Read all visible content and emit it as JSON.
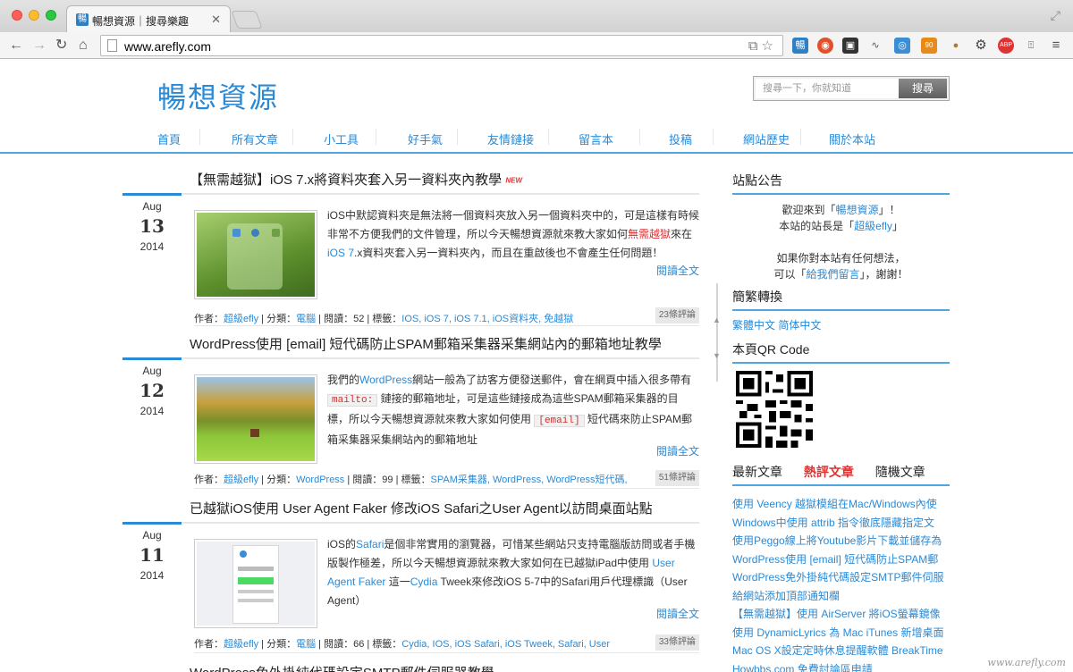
{
  "browser": {
    "tab_favicon": "暢",
    "tab_title": "暢想資源｜搜尋樂趣",
    "url": "www.arefly.com",
    "ext_badge": "90"
  },
  "site": {
    "logo": "暢想資源",
    "search_placeholder": "搜尋一下，你就知道",
    "search_button": "搜尋",
    "nav": [
      "首頁",
      "所有文章",
      "小工具",
      "好手氣",
      "友情鏈接",
      "留言本",
      "投稿",
      "網站歷史",
      "關於本站"
    ]
  },
  "posts": [
    {
      "title": "【無需越獄】iOS 7.x將資料夾套入另一資料夾內教學",
      "badge": "NEW",
      "month": "Aug",
      "day": "13",
      "year": "2014",
      "excerpt_html_parts": {
        "a": "iOS中默認資料夾是無法將一個資料夾放入另一個資料夾中的，可是這樣有時候非常不方便我們的文件管理，所以今天暢想資源就來教大家如何",
        "b": "無需越獄",
        "c": "來在",
        "d": "iOS 7",
        "e": ".x資料夾套入另一資料夾內，而且在重啟後也不會產生任何問題！"
      },
      "readmore": "閱讀全文",
      "meta": {
        "author_label": "作者：",
        "author": "超級efly",
        "cat_label": " | 分類：",
        "cat": "電腦",
        "views": " | 閱讀：52 | 標籤：",
        "tags": "IOS, iOS 7, iOS 7.1, iOS資料夾, 免越獄"
      },
      "comments": "23條評論"
    },
    {
      "title": "WordPress使用 [email] 短代碼防止SPAM郵箱采集器采集網站內的郵箱地址教學",
      "month": "Aug",
      "day": "12",
      "year": "2014",
      "excerpt_html_parts": {
        "a": "我們的",
        "b": "WordPress",
        "c": "網站一般為了訪客方便發送郵件，會在網頁中插入很多帶有",
        "code1": "mailto:",
        "d": "鏈接的郵箱地址，可是這些鏈接成為這些SPAM郵箱采集器的目標，所以今天暢想資源就來教大家如何使用",
        "code2": "[email]",
        "e": "短代碼來防止SPAM郵箱采集器采集網站內的郵箱地址"
      },
      "readmore": "閱讀全文",
      "meta": {
        "author_label": "作者：",
        "author": "超級efly",
        "cat_label": " | 分類：",
        "cat": "WordPress",
        "views": " | 閱讀：99 | 標籤：",
        "tags": "SPAM采集器, WordPress, WordPress短代碼,"
      },
      "comments": "51條評論"
    },
    {
      "title": "已越獄iOS使用 User Agent Faker 修改iOS Safari之User Agent以訪問桌面站點",
      "month": "Aug",
      "day": "11",
      "year": "2014",
      "excerpt_html_parts": {
        "a": "iOS的",
        "b": "Safari",
        "c": "是個非常實用的瀏覽器，可惜某些網站只支持電腦版訪問或者手機版製作極差，所以今天暢想資源就來教大家如何在已越獄iPad中使用 ",
        "d": "User Agent Faker",
        "e": " 這一",
        "f": "Cydia",
        "g": " Tweek來修改iOS 5-7中的Safari用戶代理標識（User Agent）"
      },
      "readmore": "閱讀全文",
      "meta": {
        "author_label": "作者：",
        "author": "超級efly",
        "cat_label": " | 分類：",
        "cat": "電腦",
        "views": " | 閱讀：66 | 標籤：",
        "tags": "Cydia, IOS, iOS Safari, iOS Tweek, Safari, User"
      },
      "comments": "33條評論"
    },
    {
      "title": "WordPress免外掛純代碼設定SMTP郵件伺服器教學"
    }
  ],
  "sidebar": {
    "notice_title": "站點公告",
    "notice_line1_pre": "歡迎來到「",
    "notice_line1_link": "暢想資源",
    "notice_line1_post": "」！",
    "notice_line2_pre": "本站的站長是「",
    "notice_line2_link": "超級efly",
    "notice_line2_post": "」",
    "notice_line3": "如果你對本站有任何想法，",
    "notice_line4_pre": "可以「",
    "notice_line4_link": "給我們留言",
    "notice_line4_post": "」，謝謝！",
    "convert_title": "簡繁轉換",
    "convert_trad": "繁體中文",
    "convert_simp": "简体中文",
    "qr_title": "本頁QR Code",
    "tabs": [
      "最新文章",
      "熱評文章",
      "隨機文章"
    ],
    "recent": [
      "使用 Veency 越獄模組在Mac/Windows內使",
      "Windows中使用 attrib 指令徹底隱藏指定文",
      "使用Peggo線上將Youtube影片下載並儲存為",
      "WordPress使用 [email] 短代碼防止SPAM郵",
      "WordPress免外掛純代碼設定SMTP郵件伺服",
      "給網站添加頂部通知欄",
      "【無需越獄】使用 AirServer 將iOS螢幕鏡像",
      "使用 DynamicLyrics 為 Mac iTunes 新增桌面",
      "Mac OS X設定定時休息提醒軟體 BreakTime",
      "Howbbs.com 免費討論區申請"
    ]
  },
  "watermark": "www.arefly.com"
}
